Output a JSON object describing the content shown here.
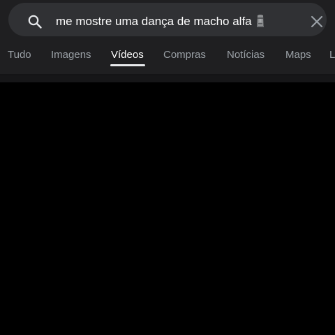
{
  "search": {
    "query": "me mostre uma dança de macho alfa",
    "emoji": "moai-icon"
  },
  "tabs": [
    {
      "label": "Tudo",
      "active": false
    },
    {
      "label": "Imagens",
      "active": false
    },
    {
      "label": "Vídeos",
      "active": true
    },
    {
      "label": "Compras",
      "active": false
    },
    {
      "label": "Notícias",
      "active": false
    },
    {
      "label": "Maps",
      "active": false
    },
    {
      "label": "L",
      "active": false
    }
  ],
  "colors": {
    "background": "#000000",
    "header": "#1f1f21",
    "search_bar": "#303134",
    "text_active": "#ffffff",
    "text_inactive": "#9aa0a6"
  }
}
